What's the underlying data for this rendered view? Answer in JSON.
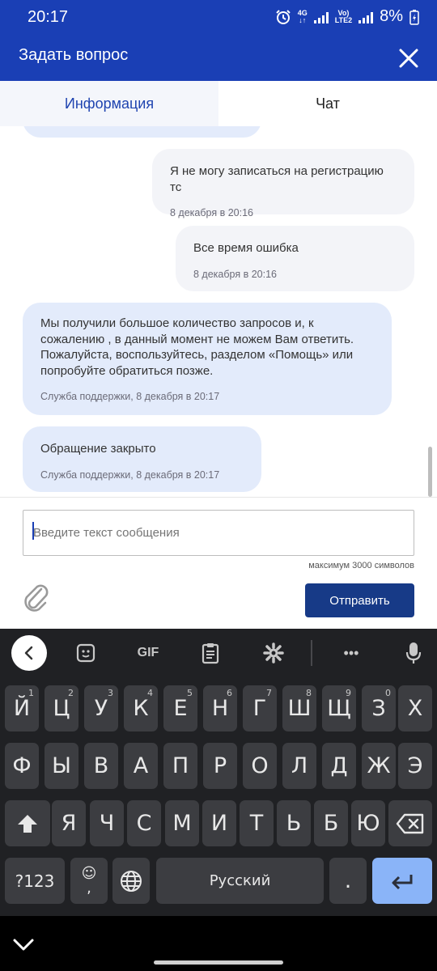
{
  "status_bar": {
    "time": "20:17",
    "network_4g": "4G",
    "volte": "Vo)",
    "lte2": "LTE2",
    "battery": "8%"
  },
  "header": {
    "title": "Задать вопрос"
  },
  "tabs": [
    {
      "label": "Информация",
      "active": false
    },
    {
      "label": "Чат",
      "active": true
    }
  ],
  "messages": [
    {
      "direction": "out",
      "text": "Я не могу записаться на регистрацию тс",
      "meta": "8 декабря в 20:16"
    },
    {
      "direction": "out",
      "text": "Все время ошибка",
      "meta": "8 декабря в 20:16"
    },
    {
      "direction": "in",
      "text": "Мы получили большое количество запросов и, к сожалению , в данный момент не можем Вам ответить. Пожалуйста, воспользуйтесь, разделом «Помощь» или попробуйте обратиться позже.",
      "meta": "Служба поддержки, 8 декабря в 20:17"
    },
    {
      "direction": "in",
      "text": "Обращение закрыто",
      "meta": "Служба поддержки, 8 декабря в 20:17"
    }
  ],
  "composer": {
    "placeholder": "Введите текст сообщения",
    "value": "",
    "char_limit": "максимум 3000 символов",
    "send_label": "Отправить"
  },
  "keyboard": {
    "toolbar": {
      "gif_label": "GIF",
      "more_label": "•••"
    },
    "row1": [
      {
        "c": "Й",
        "h": "1"
      },
      {
        "c": "Ц",
        "h": "2"
      },
      {
        "c": "У",
        "h": "3"
      },
      {
        "c": "К",
        "h": "4"
      },
      {
        "c": "Е",
        "h": "5"
      },
      {
        "c": "Н",
        "h": "6"
      },
      {
        "c": "Г",
        "h": "7"
      },
      {
        "c": "Ш",
        "h": "8"
      },
      {
        "c": "Щ",
        "h": "9"
      },
      {
        "c": "З",
        "h": "0"
      },
      {
        "c": "Х",
        "h": ""
      }
    ],
    "row2": [
      "Ф",
      "Ы",
      "В",
      "А",
      "П",
      "Р",
      "О",
      "Л",
      "Д",
      "Ж",
      "Э"
    ],
    "row3": [
      "Я",
      "Ч",
      "С",
      "М",
      "И",
      "Т",
      "Ь",
      "Б",
      "Ю"
    ],
    "symbols_label": "?123",
    "emoji_label": "☺",
    "comma_label": ",",
    "space_label": "Русский",
    "period_label": "."
  },
  "colors": {
    "primary": "#1a3fb5",
    "send_button": "#173a87",
    "incoming_bubble": "#e3ebfb",
    "outgoing_bubble": "#f3f4f8",
    "keyboard_bg": "#202124",
    "key_bg": "#3c3d41",
    "enter_key": "#8ab4f8"
  }
}
